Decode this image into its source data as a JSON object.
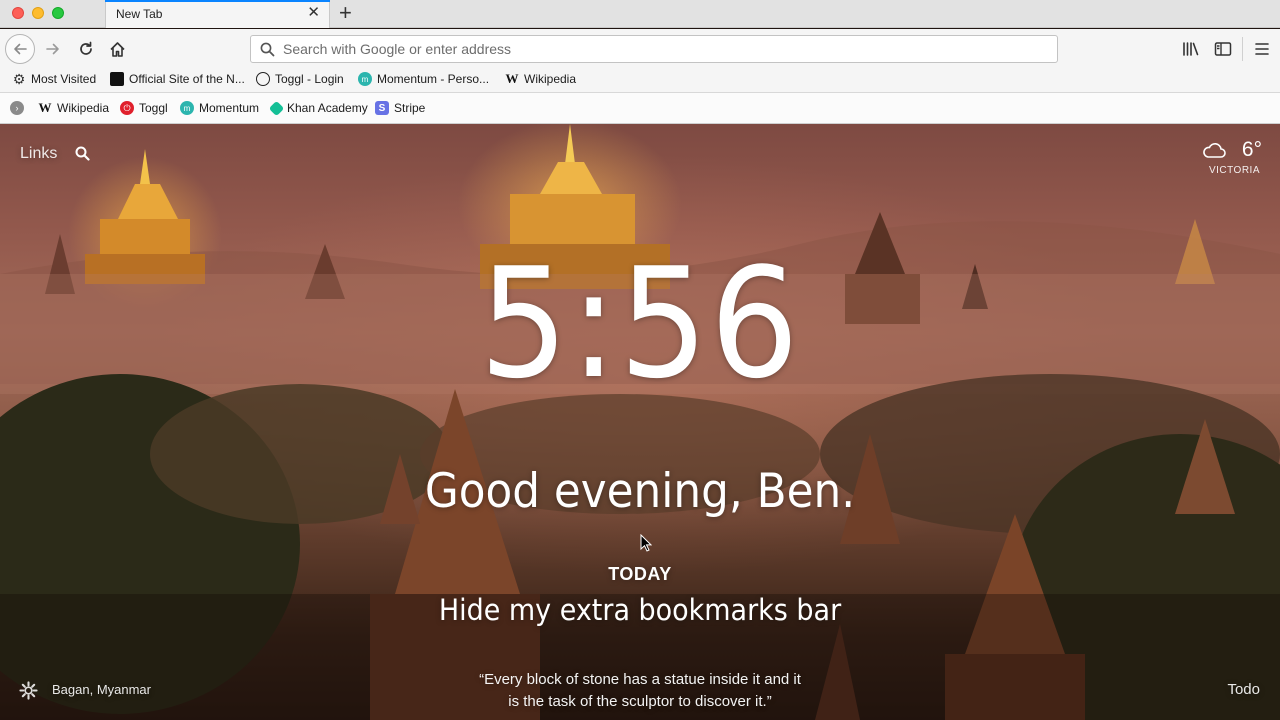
{
  "tab": {
    "title": "New Tab",
    "close": "✕",
    "new_tab": "+"
  },
  "toolbar": {
    "search_placeholder": "Search with Google or enter address"
  },
  "bookmarks_bar_1": [
    {
      "label": "Most Visited",
      "icon": "gear-icon"
    },
    {
      "label": "Official Site of the N...",
      "icon": "nhl-icon"
    },
    {
      "label": "Toggl - Login",
      "icon": "globe-icon"
    },
    {
      "label": "Momentum - Perso...",
      "icon": "momentum-icon"
    },
    {
      "label": "Wikipedia",
      "icon": "wikipedia-icon"
    }
  ],
  "bookmarks_bar_2": [
    {
      "label": "Wikipedia",
      "icon": "wikipedia-icon"
    },
    {
      "label": "Toggl",
      "icon": "toggl-icon"
    },
    {
      "label": "Momentum",
      "icon": "momentum-icon"
    },
    {
      "label": "Khan Academy",
      "icon": "khan-academy-icon"
    },
    {
      "label": "Stripe",
      "icon": "stripe-icon"
    }
  ],
  "momentum": {
    "links_label": "Links",
    "weather": {
      "temp": "6°",
      "location": "VICTORIA"
    },
    "clock": "5:56",
    "greeting": "Good evening, Ben.",
    "today_label": "TODAY",
    "focus": "Hide my extra bookmarks bar",
    "quote_line1": "“Every block of stone has a statue inside it and it",
    "quote_line2": "is the task of the sculptor to discover it.”",
    "photo_location": "Bagan, Myanmar",
    "todo_label": "Todo"
  }
}
